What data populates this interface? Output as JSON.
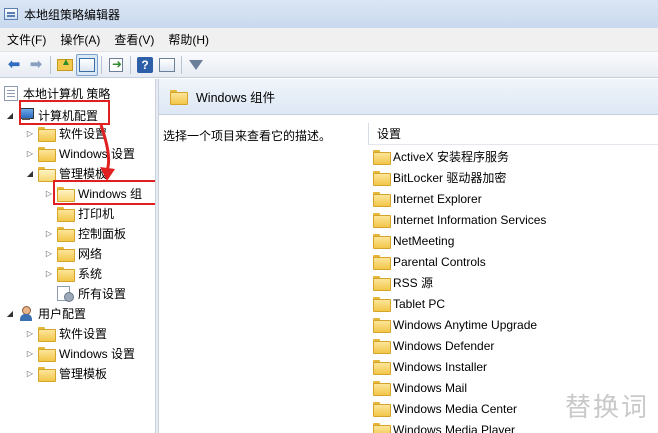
{
  "window": {
    "title": "本地组策略编辑器"
  },
  "menu": {
    "items": [
      "文件(F)",
      "操作(A)",
      "查看(V)",
      "帮助(H)"
    ]
  },
  "toolbar": {
    "buttons": [
      "back-arrow-icon",
      "forward-arrow-icon",
      "up-folder-icon",
      "show-hide-tree-icon",
      "export-list-icon",
      "help-icon",
      "properties-icon",
      "filter-icon"
    ]
  },
  "tree": {
    "root": "本地计算机 策略",
    "computer_config": "计算机配置",
    "cc_software": "软件设置",
    "cc_windows": "Windows 设置",
    "cc_admin": "管理模板",
    "cc_admin_windows": "Windows 组",
    "cc_admin_printers": "打印机",
    "cc_admin_control_panel": "控制面板",
    "cc_admin_network": "网络",
    "cc_admin_system": "系统",
    "cc_admin_all": "所有设置",
    "user_config": "用户配置",
    "uc_software": "软件设置",
    "uc_windows": "Windows 设置",
    "uc_admin": "管理模板"
  },
  "right": {
    "header_title": "Windows 组件",
    "description": "选择一个项目来查看它的描述。",
    "column_header": "设置",
    "items": [
      "ActiveX 安装程序服务",
      "BitLocker 驱动器加密",
      "Internet Explorer",
      "Internet Information Services",
      "NetMeeting",
      "Parental Controls",
      "RSS 源",
      "Tablet PC",
      "Windows Anytime Upgrade",
      "Windows Defender",
      "Windows Installer",
      "Windows Mail",
      "Windows Media Center",
      "Windows Media Player"
    ]
  },
  "watermark": "替换词",
  "colors": {
    "highlight": "#e02020",
    "accent": "#2f6bc0"
  }
}
